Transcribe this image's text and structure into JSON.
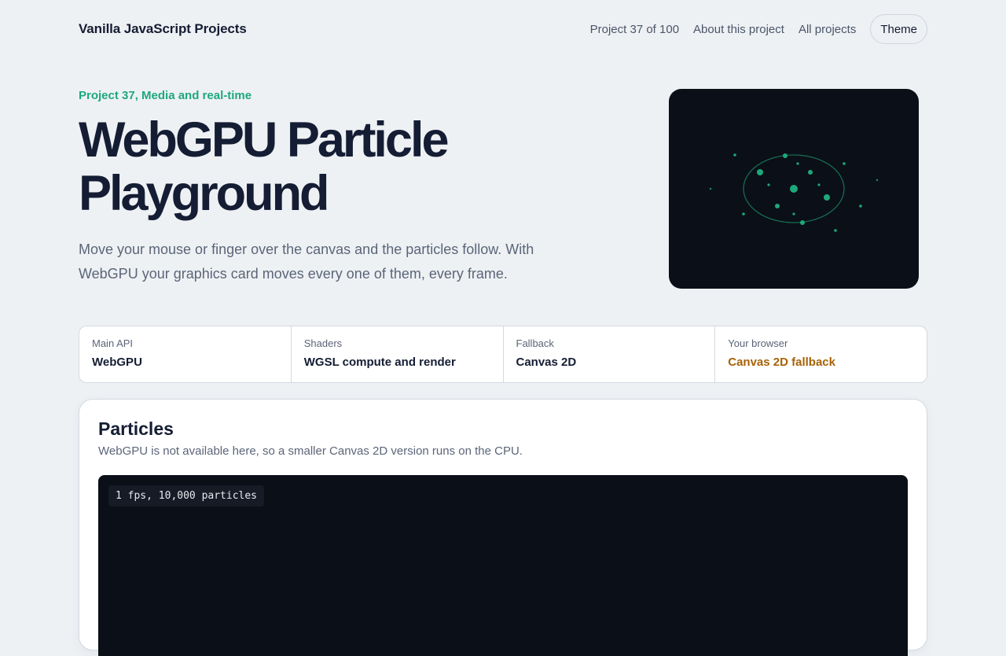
{
  "header": {
    "brand": "Vanilla JavaScript Projects",
    "progress": "Project 37 of 100",
    "about_link": "About this project",
    "all_link": "All projects",
    "theme_button": "Theme"
  },
  "hero": {
    "eyebrow": "Project 37, Media and real-time",
    "title_line1": "WebGPU Particle",
    "title_line2": "Playground",
    "description": "Move your mouse or finger over the canvas and the particles follow. With WebGPU your graphics card moves every one of them, every frame."
  },
  "stats": [
    {
      "label": "Main API",
      "value": "WebGPU"
    },
    {
      "label": "Shaders",
      "value": "WGSL compute and render"
    },
    {
      "label": "Fallback",
      "value": "Canvas 2D"
    },
    {
      "label": "Your browser",
      "value": "Canvas 2D fallback"
    }
  ],
  "panel": {
    "title": "Particles",
    "subtitle": "WebGPU is not available here, so a smaller Canvas 2D version runs on the CPU.",
    "fps_readout": "1 fps, 10,000 particles"
  },
  "colors": {
    "accent_green": "#1ea87a",
    "warning_amber": "#a76207",
    "canvas_bg": "#0b0f18",
    "page_bg": "#eef1f4"
  }
}
